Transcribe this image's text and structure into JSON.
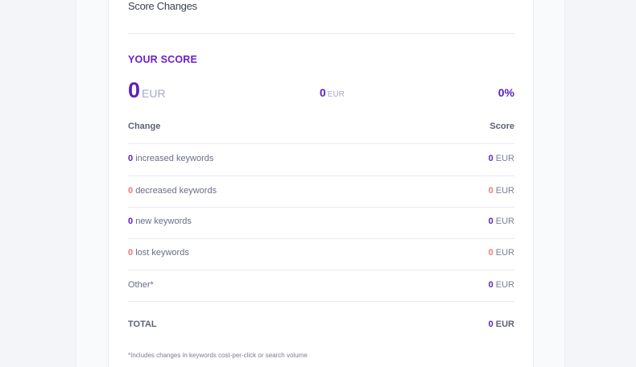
{
  "card": {
    "title": "Score Changes"
  },
  "score": {
    "heading": "YOUR SCORE",
    "main_value": "0",
    "main_unit": "EUR",
    "secondary_value": "0",
    "secondary_unit": "EUR",
    "percent": "0%"
  },
  "table": {
    "col_change": "Change",
    "col_score": "Score",
    "rows": [
      {
        "count": "0",
        "count_type": "pos",
        "label": "increased keywords",
        "value": "0",
        "value_type": "pos",
        "unit": "EUR"
      },
      {
        "count": "0",
        "count_type": "neg",
        "label": "decreased keywords",
        "value": "0",
        "value_type": "neg",
        "unit": "EUR"
      },
      {
        "count": "0",
        "count_type": "pos",
        "label": "new keywords",
        "value": "0",
        "value_type": "pos",
        "unit": "EUR"
      },
      {
        "count": "0",
        "count_type": "neg",
        "label": "lost keywords",
        "value": "0",
        "value_type": "neg",
        "unit": "EUR"
      },
      {
        "count": "",
        "count_type": "none",
        "label": "Other*",
        "value": "0",
        "value_type": "pos",
        "unit": "EUR"
      }
    ]
  },
  "total": {
    "label": "TOTAL",
    "value": "0",
    "unit": "EUR"
  },
  "footnote": "*Includes changes in keywords cost-per-click or search volume",
  "colors": {
    "accent": "#5b1fc0",
    "heading": "#6a1fd1",
    "negative": "#f07777"
  }
}
